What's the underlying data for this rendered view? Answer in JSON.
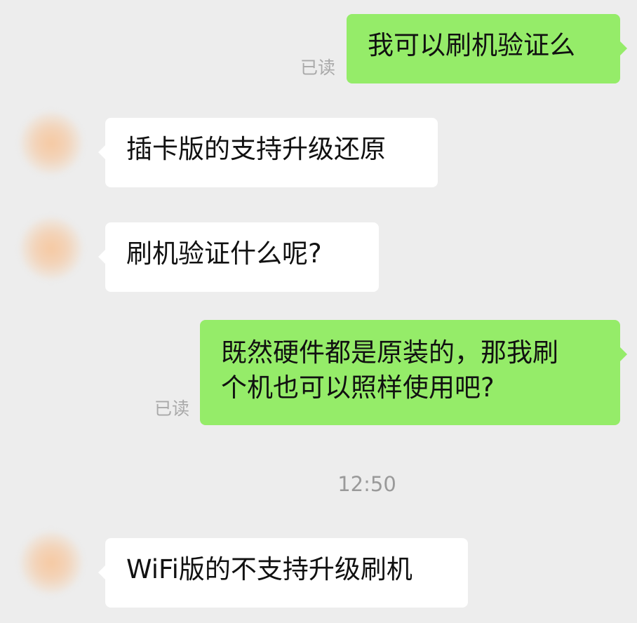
{
  "colors": {
    "background": "#ededed",
    "outgoing_bubble": "#95ec69",
    "incoming_bubble": "#ffffff",
    "read_receipt": "#a9a9a9",
    "timestamp": "#9a9a9a"
  },
  "messages": [
    {
      "direction": "outgoing",
      "text": "我可以刷机验证么",
      "status": "已读"
    },
    {
      "direction": "incoming",
      "text": "插卡版的支持升级还原"
    },
    {
      "direction": "incoming",
      "text": "刷机验证什么呢?"
    },
    {
      "direction": "outgoing",
      "text": "既然硬件都是原装的，那我刷\n个机也可以照样使用吧?",
      "status": "已读"
    },
    {
      "direction": "incoming",
      "text": "WiFi版的不支持升级刷机"
    }
  ],
  "timestamp": "12:50"
}
